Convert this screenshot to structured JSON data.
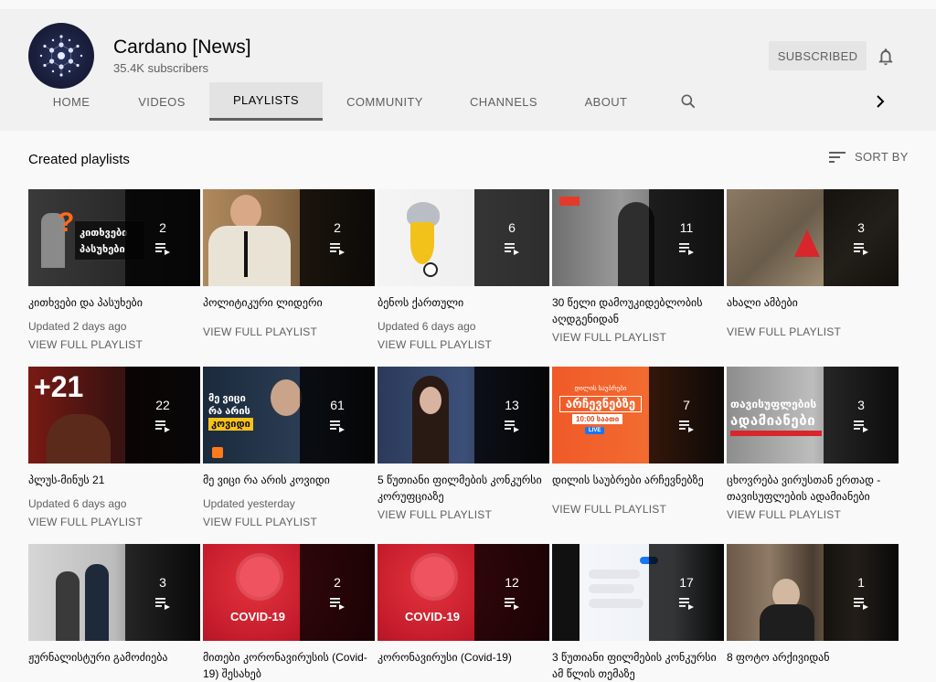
{
  "channel": {
    "name": "Cardano [News]",
    "subscribers": "35.4K subscribers",
    "subscribe_label": "SUBSCRIBED",
    "bell_icon": "bell-icon"
  },
  "tabs": [
    {
      "label": "HOME"
    },
    {
      "label": "VIDEOS"
    },
    {
      "label": "PLAYLISTS"
    },
    {
      "label": "COMMUNITY"
    },
    {
      "label": "CHANNELS"
    },
    {
      "label": "ABOUT"
    }
  ],
  "section": {
    "title": "Created playlists",
    "sort_label": "SORT BY"
  },
  "playlists": [
    {
      "count": "2",
      "title": "კითხვები და პასუხები",
      "updated": "Updated 2 days ago",
      "view": "VIEW FULL PLAYLIST"
    },
    {
      "count": "2",
      "title": "პოლიტიკური ლიდერი",
      "updated": "",
      "view": "VIEW FULL PLAYLIST"
    },
    {
      "count": "6",
      "title": "ბენოს ქართული",
      "updated": "Updated 6 days ago",
      "view": "VIEW FULL PLAYLIST"
    },
    {
      "count": "11",
      "title": "30 წელი დამოუკიდებლობის აღდგენიდან",
      "updated": "",
      "view": "VIEW FULL PLAYLIST"
    },
    {
      "count": "3",
      "title": "ახალი ამბები",
      "updated": "",
      "view": "VIEW FULL PLAYLIST"
    },
    {
      "count": "22",
      "title": "პლუს-მინუს 21",
      "updated": "Updated 6 days ago",
      "view": "VIEW FULL PLAYLIST"
    },
    {
      "count": "61",
      "title": "მე ვიცი რა არის კოვიდი",
      "updated": "Updated yesterday",
      "view": "VIEW FULL PLAYLIST"
    },
    {
      "count": "13",
      "title": "5 წუთიანი ფილმების კონკურსი კორუფციაზე",
      "updated": "",
      "view": "VIEW FULL PLAYLIST"
    },
    {
      "count": "7",
      "title": "დილის საუბრები არჩევნებზე",
      "updated": "",
      "view": "VIEW FULL PLAYLIST"
    },
    {
      "count": "3",
      "title": "ცხოვრება ვირუსთან ერთად - თავისუფლების ადამიანები",
      "updated": "",
      "view": "VIEW FULL PLAYLIST"
    },
    {
      "count": "3",
      "title": "ჟურნალისტური გამოძიება",
      "updated": "",
      "view": ""
    },
    {
      "count": "2",
      "title": "მითები კორონავირუსის (Covid-19) შესახებ",
      "updated": "",
      "view": ""
    },
    {
      "count": "12",
      "title": "კორონავირუსი (Covid-19)",
      "updated": "",
      "view": ""
    },
    {
      "count": "17",
      "title": "3 წუთიანი ფილმების კონკურსი ამ წლის თემაზე",
      "updated": "",
      "view": ""
    },
    {
      "count": "1",
      "title": "8 ფოტო არქივიდან",
      "updated": "",
      "view": ""
    }
  ],
  "thumb_text": {
    "t0": "კითხვები პასუხები",
    "t5": "+21",
    "t6a": "მე ვიცი",
    "t6b": "რა არის",
    "t6c": "კოვიდი",
    "t8a": "დილის საუბრები",
    "t8b": "არჩევნებზე",
    "t8c": "10:00 საათი",
    "t8d": "LIVE",
    "t9a": "თავისუფლების",
    "t9b": "ადამიანები",
    "t11": "COVID-19",
    "t12": "COVID-19"
  },
  "colors": {
    "accent": "#ff5722",
    "covid_red": "#c41b2b",
    "header_bg": "#f1f1f1",
    "page_bg": "#f9f9f9"
  }
}
